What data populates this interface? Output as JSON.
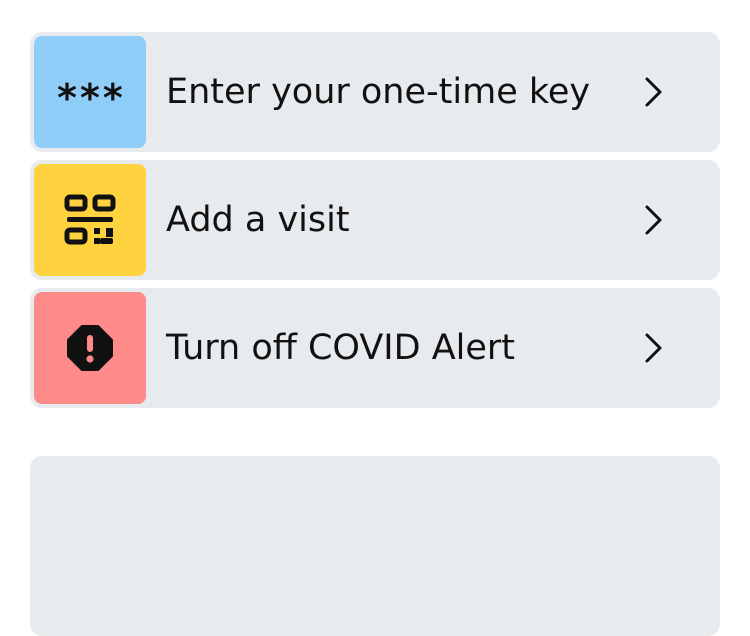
{
  "menu": {
    "items": [
      {
        "label": "Enter your one-time key",
        "icon_text": "***",
        "icon": "asterisks-icon",
        "tile_color": "#8fcdf9"
      },
      {
        "label": "Add a visit",
        "icon": "qr-code-icon",
        "tile_color": "#ffd33f"
      },
      {
        "label": "Turn off COVID Alert",
        "icon": "alert-octagon-icon",
        "tile_color": "#ff8a8a"
      }
    ]
  },
  "colors": {
    "row_background": "#e8ebee",
    "text": "#111111",
    "page_background": "#ffffff"
  }
}
